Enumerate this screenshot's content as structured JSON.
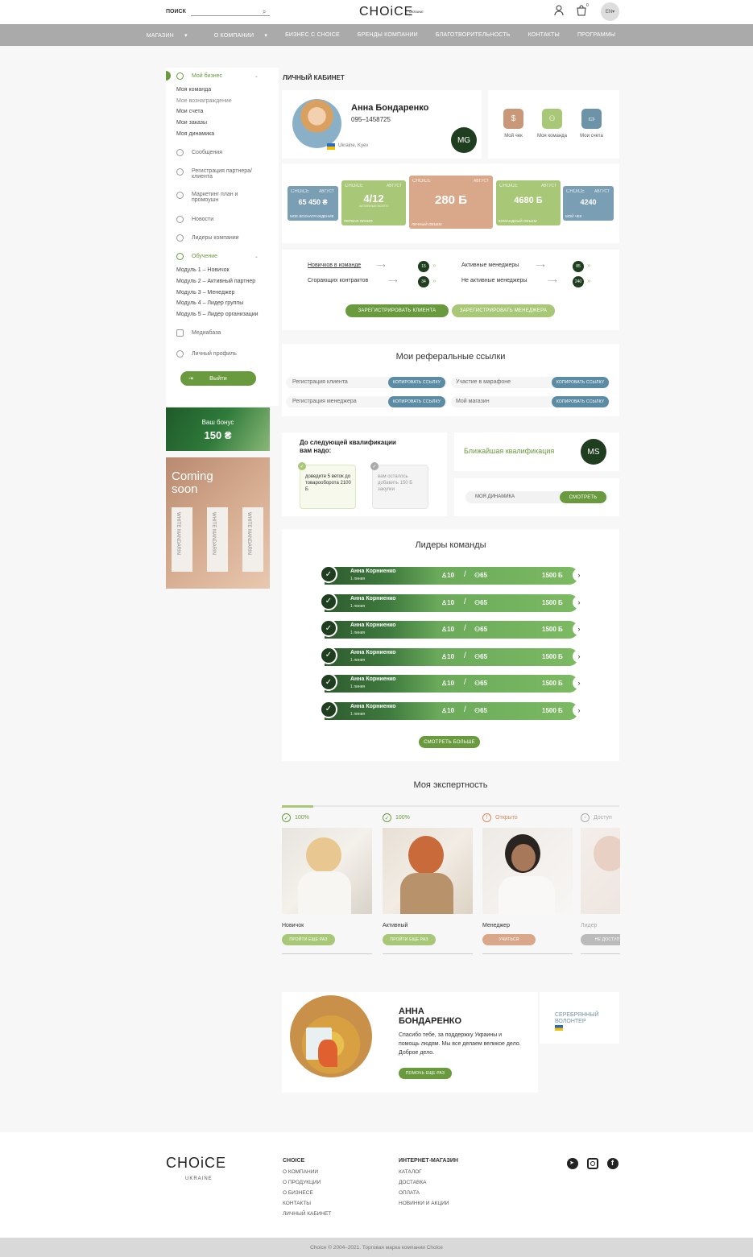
{
  "header": {
    "search_label": "ПОИСК",
    "logo": "CHOiCE",
    "logo_sub": "UKRAINE",
    "cart_count": "0",
    "lang": "EN"
  },
  "nav": [
    "МАГАЗИН",
    "О КОМПАНИИ",
    "БИЗНЕС С CHOICE",
    "БРЕНДЫ КОМПАНИИ",
    "БЛАГОТВОРИТЕЛЬНОСТЬ",
    "КОНТАКТЫ",
    "ПРОГРАММЫ"
  ],
  "sidebar": {
    "my_business": "Мой бизнес",
    "sub": [
      "Моя команда",
      "Мое вознаграждение",
      "Мои счета",
      "Мои заказы",
      "Моя динамика"
    ],
    "messages": "Сообщения",
    "partner_reg": "Регистрация партнера/ клиента",
    "marketing": "Маркетинг план и промоушн",
    "news": "Новости",
    "leaders": "Лидеры компании",
    "education": "Обучение",
    "modules": [
      "Модуль 1 – Новичок",
      "Модуль 2 – Активный партнер",
      "Модуль 3 – Менеджер",
      "Модуль 4 – Лидер группы",
      "Модуль 5 – Лидер организации"
    ],
    "media": "Медиабаза",
    "profile": "Личный профиль",
    "logout": "Выйти"
  },
  "bonus": {
    "title": "Ваш бонус",
    "value": "150 ₴"
  },
  "coming": {
    "title": "Coming soon",
    "product": "WHITE MANDARIN"
  },
  "page_title": "ЛИЧНЫЙ КАБИНЕТ",
  "profile": {
    "name": "Анна Бондаренко",
    "phone": "095–1458725",
    "location": "Ukraine, Kyev",
    "initials": "MG"
  },
  "quick": [
    {
      "label": "Мой чек",
      "color": "#c99878"
    },
    {
      "label": "Моя команда",
      "color": "#a8c878"
    },
    {
      "label": "Мои счета",
      "color": "#6d93a8"
    }
  ],
  "stats": [
    {
      "value": "65 450 ₴",
      "label": "МОЕ ВОЗНАГРАЖДЕНИЕ",
      "month": "АВГУСТ",
      "color": "#7a9eb4"
    },
    {
      "value": "4/12",
      "label": "ПЕРВАЯ ЛИНИЯ",
      "sub": "АКТИВНЫЕ ВСЕГО",
      "month": "АВГУСТ",
      "color": "#a8c878"
    },
    {
      "value": "280 Б",
      "label": "ЛИЧНЫЙ ОБЪЕМ",
      "month": "АВГУСТ",
      "color": "#d9a88a"
    },
    {
      "value": "4680 Б",
      "label": "КОМАНДНЫЙ ОБЪЕМ",
      "month": "АВГУСТ",
      "color": "#a8c878"
    },
    {
      "value": "4240",
      "label": "МОЙ ЧЕК",
      "month": "АВГУСТ",
      "color": "#7a9eb4"
    }
  ],
  "counters": [
    {
      "label": "Новичков в команде",
      "value": "15"
    },
    {
      "label": "Сгорающих контрактов",
      "value": "34"
    },
    {
      "label": "Активные менеджеры",
      "value": "85"
    },
    {
      "label": "Не активные менеджеры",
      "value": "240"
    }
  ],
  "reg_client": "ЗАРЕГИСТРИРОВАТЬ КЛИЕНТА",
  "reg_manager": "ЗАРЕГИСТРИРОВАТЬ МЕНЕДЖЕРА",
  "referral": {
    "title": "Мои реферальные ссылки",
    "copy": "КОПИРОВАТЬ ССЫЛКУ",
    "items": [
      "Регистрация клиента",
      "Участие в марафоне",
      "Регистрация менеджера",
      "Мой магазин"
    ]
  },
  "qualification": {
    "title": "До следующей квалификации вам надо:",
    "task1": "доведите 5 веток до товарооборота 2100 Б",
    "task2": "вам осталось добавить 150 Б закупки"
  },
  "nearest": {
    "label": "Ближайшая квалификация",
    "initials": "MS"
  },
  "dynamics": {
    "label": "МОЯ ДИНАМИКА",
    "button": "СМОТРЕТЬ"
  },
  "leaders": {
    "title": "Лидеры команды",
    "more": "СМОТРЕТЬ БОЛЬШЕ",
    "rows": [
      {
        "name": "Анна Корниенко",
        "line": "1 линия",
        "a": "10",
        "b": "65",
        "points": "1500 Б"
      },
      {
        "name": "Анна Корниенко",
        "line": "1 линия",
        "a": "10",
        "b": "65",
        "points": "1500 Б"
      },
      {
        "name": "Анна Корниенко",
        "line": "1 линия",
        "a": "10",
        "b": "65",
        "points": "1500 Б"
      },
      {
        "name": "Анна Корниенко",
        "line": "1 линия",
        "a": "10",
        "b": "65",
        "points": "1500 Б"
      },
      {
        "name": "Анна Корниенко",
        "line": "1 линия",
        "a": "10",
        "b": "65",
        "points": "1500 Б"
      },
      {
        "name": "Анна Корниенко",
        "line": "1 линия",
        "a": "10",
        "b": "65",
        "points": "1500 Б"
      }
    ]
  },
  "expertise": {
    "title": "Моя экспертность",
    "cards": [
      {
        "status": "100%",
        "name": "Новичок",
        "button": "ПРОЙТИ ЕЩЕ РАЗ",
        "color": "#a8c878"
      },
      {
        "status": "100%",
        "name": "Активный",
        "button": "ПРОЙТИ ЕЩЕ РАЗ",
        "color": "#a8c878"
      },
      {
        "status": "Открыто",
        "name": "Менеджер",
        "button": "УЧИТЬСЯ",
        "color": "#d9a88a"
      },
      {
        "status": "Доступ",
        "name": "Лидер",
        "button": "НЕ ДОСТУП",
        "color": "#bbb"
      }
    ]
  },
  "volunteer": {
    "name": "АННА БОНДАРЕНКО",
    "text": "Спасибо тебе, за поддержку Украины и помощь людям. Мы все делаем великое дело. Доброе дело.",
    "button": "ПОМОЧЬ ЕЩЕ РАЗ",
    "badge": "СЕРЕБРЯННЫЙ ВОЛОНТЕР"
  },
  "footer": {
    "logo": "CHOiCE",
    "logo_sub": "UKRAINE",
    "col1_title": "CHOICE",
    "col1": [
      "О КОМПАНИИ",
      "О ПРОДУКЦИИ",
      "О БИЗНЕСЕ",
      "КОНТАКТЫ",
      "ЛИЧНЫЙ КАБИНЕТ"
    ],
    "col2_title": "ИНТЕРНЕТ-МАГАЗИН",
    "col2": [
      "КАТАЛОГ",
      "ДОСТАВКА",
      "ОПЛАТА",
      "НОВИНКИ И АКЦИИ"
    ],
    "copyright": "Choice © 2004–2021. Торговая марка компании Choice"
  }
}
